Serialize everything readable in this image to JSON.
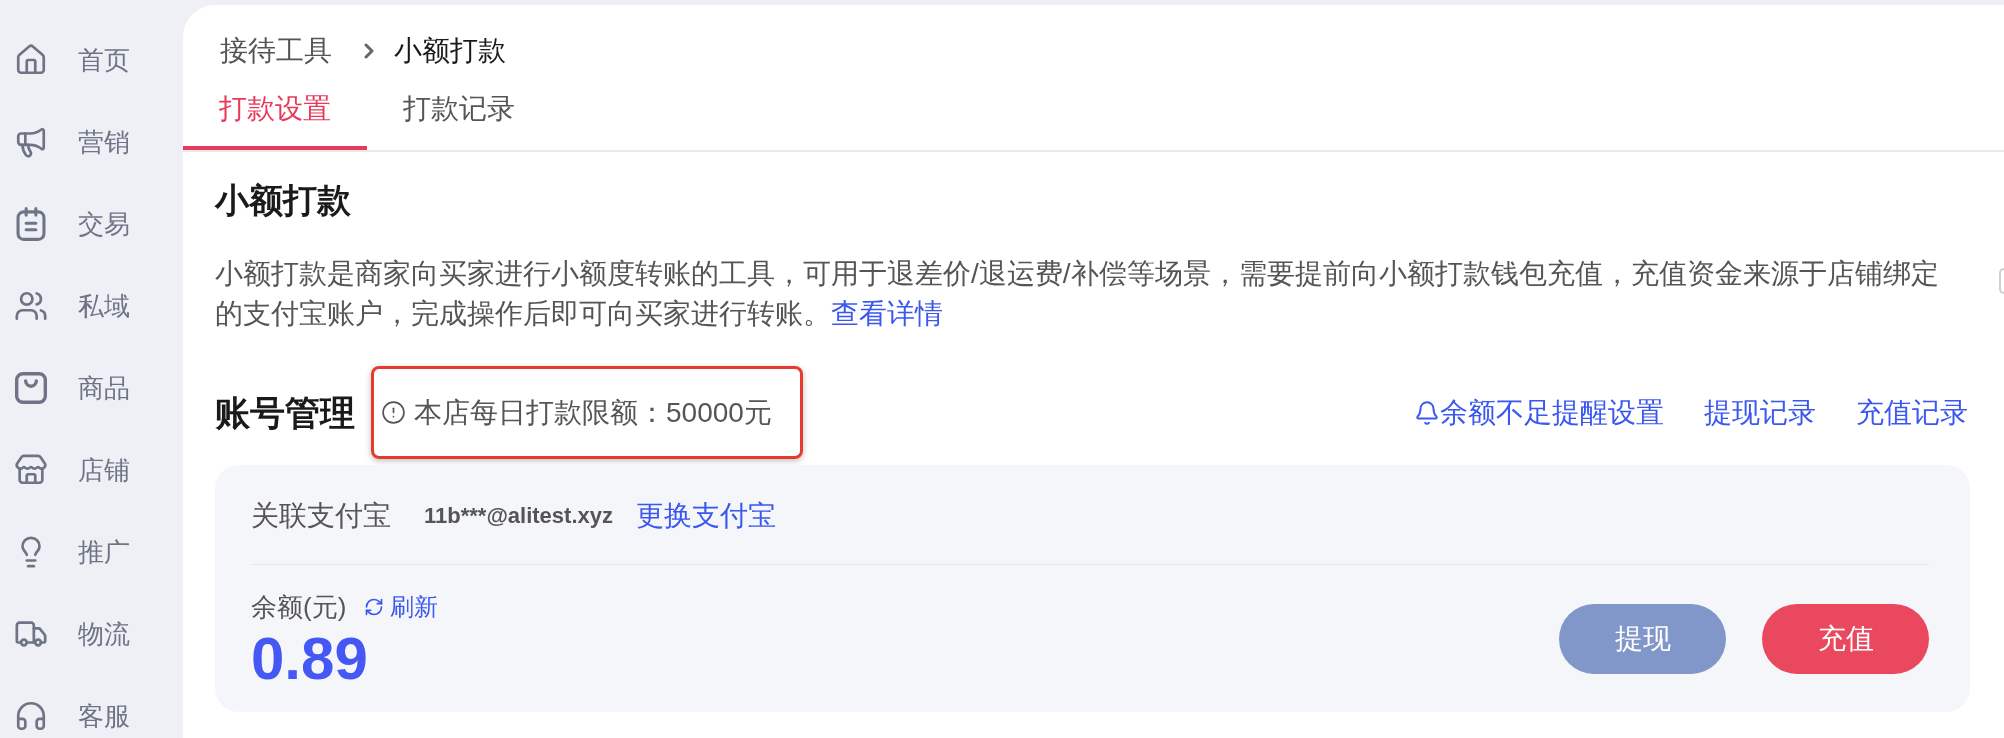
{
  "sidebar": {
    "items": [
      {
        "label": "首页",
        "selected": false
      },
      {
        "label": "营销",
        "selected": false
      },
      {
        "label": "交易",
        "selected": false
      },
      {
        "label": "私域",
        "selected": false
      },
      {
        "label": "商品",
        "selected": false
      },
      {
        "label": "店铺",
        "selected": false
      },
      {
        "label": "推广",
        "selected": false
      },
      {
        "label": "物流",
        "selected": false
      },
      {
        "label": "客服",
        "selected": false
      }
    ]
  },
  "breadcrumb": [
    {
      "label": "接待工具",
      "current": false
    },
    {
      "label": "小额打款",
      "current": true
    }
  ],
  "tabs": [
    {
      "label": "打款设置",
      "selected": true
    },
    {
      "label": "打款记录",
      "selected": false
    }
  ],
  "intro": {
    "title": "小额打款",
    "text": "小额打款是商家向买家进行小额度转账的工具，可用于退差价/退运费/补偿等场景，需要提前向小额打款钱包充值，充值资金来源于店铺绑定的支付宝账户，完成操作后即可向买家进行转账。",
    "link": "查看详情"
  },
  "account": {
    "title": "账号管理",
    "limit_note": {
      "text": "本店每日打款限额：50000元",
      "highlighted": true
    },
    "links": [
      {
        "label": "余额不足提醒设置",
        "kind": "alert"
      },
      {
        "label": "提现记录",
        "kind": "plain"
      },
      {
        "label": "充值记录",
        "kind": "plain"
      }
    ]
  },
  "alipay": {
    "label": "关联支付宝",
    "account": "11b***@alitest.xyz",
    "change_link": "更换支付宝"
  },
  "balance": {
    "label": "余额(元)",
    "refresh": "刷新",
    "amount": "0.89"
  },
  "buttons": [
    {
      "label": "提现",
      "kind": "secondary"
    },
    {
      "label": "充值",
      "kind": "primary"
    }
  ]
}
